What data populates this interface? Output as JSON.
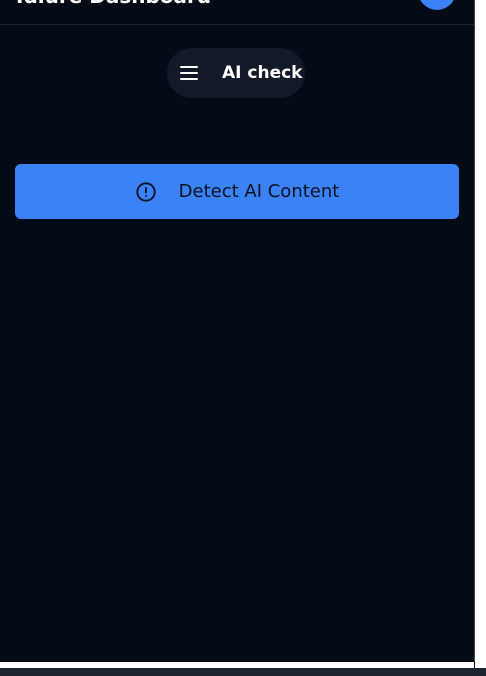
{
  "header": {
    "title": "Idlure Dashboard"
  },
  "nav": {
    "toggle_label": "AI check",
    "toggle_icon": "menu-icon"
  },
  "actions": {
    "detect_label": "Detect AI Content",
    "detect_icon": "alert-circle-icon"
  },
  "colors": {
    "background": "#050b16",
    "accent": "#3b82f6",
    "pill_background": "#121a29"
  }
}
